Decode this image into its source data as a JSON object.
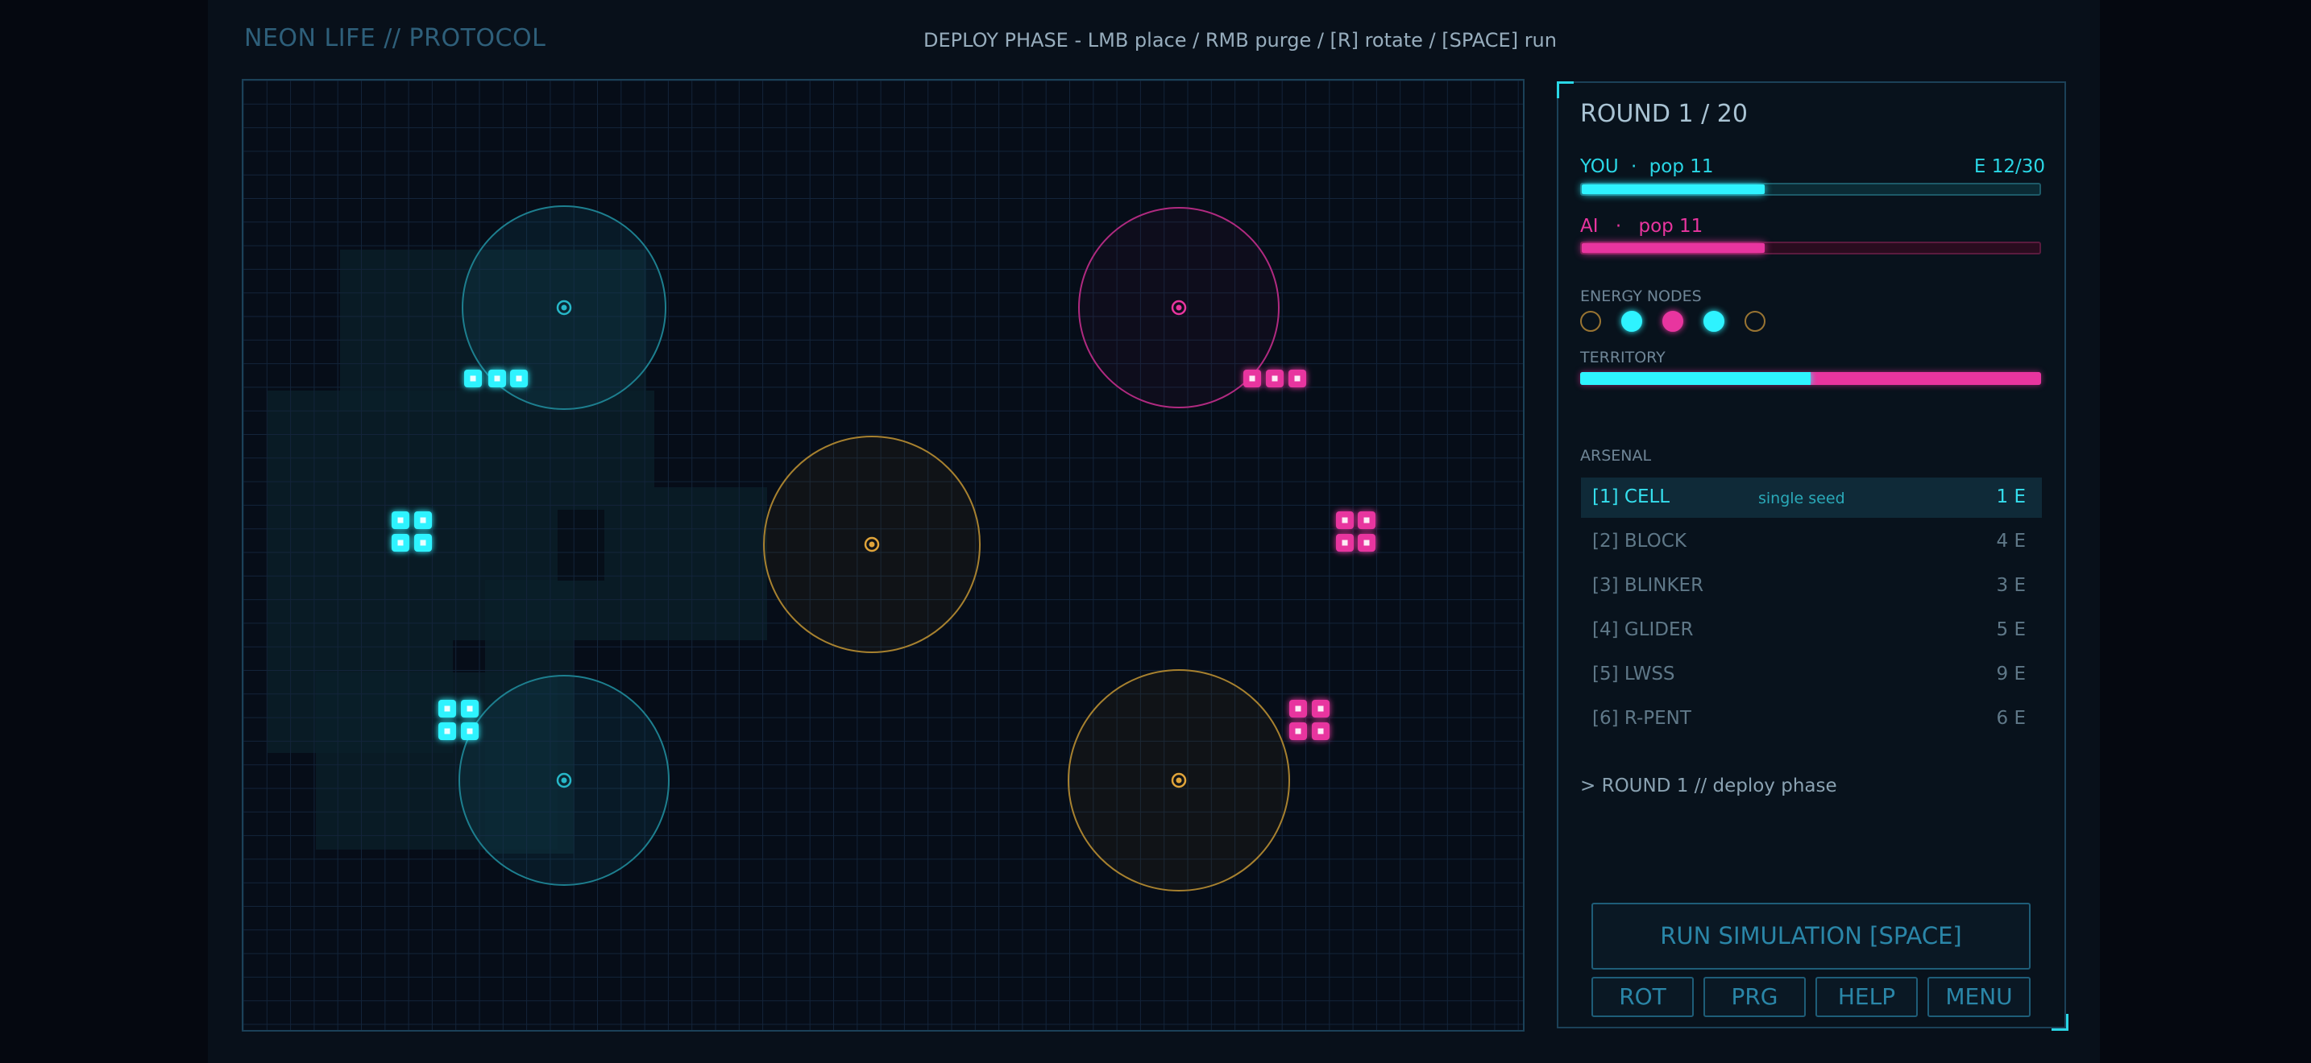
{
  "app": {
    "title": "NEON LIFE // PROTOCOL",
    "hint": "DEPLOY PHASE  -  LMB place / RMB purge / [R] rotate / [SPACE] run"
  },
  "colors": {
    "you": "#2ef3ff",
    "ai": "#e8359f",
    "neutral": "#c9953a",
    "background": "#060d18",
    "grid": "#13243a"
  },
  "board": {
    "zones": [
      {
        "owner": "you",
        "label": "base-zone-you-top"
      },
      {
        "owner": "ai",
        "label": "base-zone-ai-top"
      },
      {
        "owner": "neutral",
        "label": "energy-zone-center"
      },
      {
        "owner": "you",
        "label": "base-zone-you-bottom"
      },
      {
        "owner": "neutral",
        "label": "energy-zone-bottom-right"
      }
    ],
    "patterns": [
      {
        "owner": "you",
        "pattern": "blinker"
      },
      {
        "owner": "ai",
        "pattern": "blinker"
      },
      {
        "owner": "you",
        "pattern": "block"
      },
      {
        "owner": "ai",
        "pattern": "block"
      },
      {
        "owner": "you",
        "pattern": "block"
      },
      {
        "owner": "ai",
        "pattern": "block"
      }
    ]
  },
  "panel": {
    "round": "ROUND 1 / 20",
    "you": {
      "name": "YOU",
      "sep": "·",
      "pop_label": "pop 11",
      "energy_label": "E 12/30",
      "bar_fraction": 0.4
    },
    "ai": {
      "name": "AI",
      "sep": "·",
      "pop_label": "pop 11",
      "bar_fraction": 0.4
    },
    "energy_nodes_label": "ENERGY NODES",
    "energy_nodes": [
      "neutral",
      "you",
      "ai",
      "you",
      "neutral"
    ],
    "territory_label": "TERRITORY",
    "territory_you_fraction": 0.5,
    "arsenal_label": "ARSENAL",
    "arsenal": [
      {
        "label": "[1] CELL",
        "desc": "single seed",
        "cost": "1 E",
        "selected": true
      },
      {
        "label": "[2] BLOCK",
        "desc": "",
        "cost": "4 E",
        "selected": false
      },
      {
        "label": "[3] BLINKER",
        "desc": "",
        "cost": "3 E",
        "selected": false
      },
      {
        "label": "[4] GLIDER",
        "desc": "",
        "cost": "5 E",
        "selected": false
      },
      {
        "label": "[5] LWSS",
        "desc": "",
        "cost": "9 E",
        "selected": false
      },
      {
        "label": "[6] R-PENT",
        "desc": "",
        "cost": "6 E",
        "selected": false
      }
    ],
    "log": "> ROUND 1 // deploy phase",
    "buttons": {
      "run": "RUN SIMULATION  [SPACE]",
      "rot": "ROT",
      "prg": "PRG",
      "help": "HELP",
      "menu": "MENU"
    }
  }
}
